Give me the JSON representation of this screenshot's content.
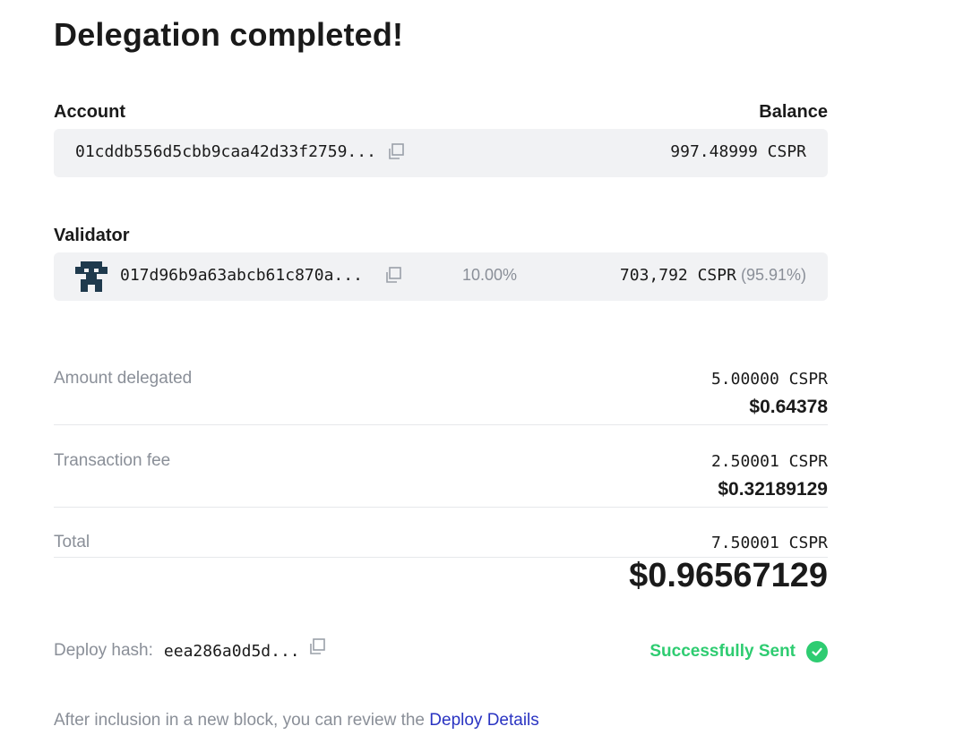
{
  "header": {
    "title": "Delegation completed!"
  },
  "account": {
    "label": "Account",
    "balance_label": "Balance",
    "address": "01cddb556d5cbb9caa42d33f2759...",
    "balance": "997.48999 CSPR"
  },
  "validator": {
    "label": "Validator",
    "address": "017d96b9a63abcb61c870a...",
    "fee": "10.00%",
    "stake": "703,792 CSPR",
    "stake_percent": "(95.91%)"
  },
  "summary": {
    "amount": {
      "label": "Amount delegated",
      "cspr": "5.00000 CSPR",
      "usd": "$0.64378"
    },
    "fee": {
      "label": "Transaction fee",
      "cspr": "2.50001 CSPR",
      "usd": "$0.32189129"
    },
    "total": {
      "label": "Total",
      "cspr": "7.50001 CSPR",
      "usd": "$0.96567129"
    }
  },
  "deploy": {
    "label": "Deploy hash:",
    "hash": "eea286a0d5d...",
    "status": "Successfully Sent"
  },
  "footer": {
    "text": "After inclusion in a new block, you can review the ",
    "link": "Deploy Details"
  },
  "colors": {
    "success": "#2ecc71",
    "link": "#2a34c2",
    "muted": "#8a8f98",
    "box_bg": "#f1f2f4",
    "avatar": "#1f3a4d"
  },
  "icons": [
    "copy-icon",
    "validator-avatar-icon",
    "check-circle-icon"
  ]
}
